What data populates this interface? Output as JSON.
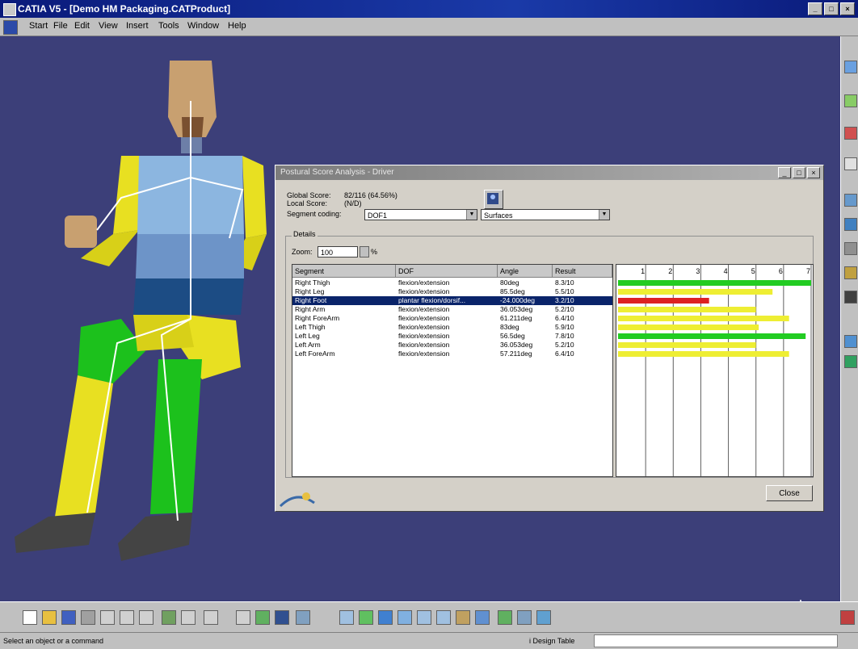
{
  "window": {
    "title": "CATIA V5 - [Demo HM Packaging.CATProduct]",
    "buttons": [
      "_",
      "□",
      "×"
    ]
  },
  "menubar": {
    "items": [
      "Start",
      "File",
      "Edit",
      "View",
      "Insert",
      "Tools",
      "Window",
      "Help"
    ]
  },
  "status": {
    "text": "Select an object or a command",
    "design_table_label": "i Design Table"
  },
  "dialog": {
    "title": "Postural Score Analysis - Driver",
    "global_score_label": "Global Score:",
    "global_score_value": "82/116  (64.56%)",
    "local_score_label": "Local Score:",
    "local_score_value": "(N/D)",
    "segment_coding_label": "Segment coding:",
    "segment_coding_value": "DOF1",
    "display_mode_value": "Surfaces",
    "details_label": "Details",
    "zoom_label": "Zoom:",
    "zoom_value": "100",
    "zoom_unit": "%",
    "close_label": "Close",
    "columns": [
      "Segment",
      "DOF",
      "Angle",
      "Result"
    ],
    "scale_ticks": [
      "1",
      "2",
      "3",
      "4",
      "5",
      "6",
      "7"
    ],
    "rows": [
      {
        "segment": "Right Thigh",
        "dof": "flexion/extension",
        "angle": "80deg",
        "result": "8.3/10",
        "score": 7.0,
        "color": "#22cc22",
        "selected": false
      },
      {
        "segment": "Right Leg",
        "dof": "flexion/extension",
        "angle": "85.5deg",
        "result": "5.5/10",
        "score": 5.6,
        "color": "#eeee33",
        "selected": false
      },
      {
        "segment": "Right Foot",
        "dof": "plantar flexion/dorsif...",
        "angle": "-24.000deg",
        "result": "3.2/10",
        "score": 3.3,
        "color": "#dd2222",
        "selected": true
      },
      {
        "segment": "Right Arm",
        "dof": "flexion/extension",
        "angle": "36.053deg",
        "result": "5.2/10",
        "score": 5.0,
        "color": "#eeee33",
        "selected": false
      },
      {
        "segment": "Right ForeArm",
        "dof": "flexion/extension",
        "angle": "61.211deg",
        "result": "6.4/10",
        "score": 6.2,
        "color": "#eeee33",
        "selected": false
      },
      {
        "segment": "Left Thigh",
        "dof": "flexion/extension",
        "angle": "83deg",
        "result": "5.9/10",
        "score": 5.1,
        "color": "#eeee33",
        "selected": false
      },
      {
        "segment": "Left Leg",
        "dof": "flexion/extension",
        "angle": "56.5deg",
        "result": "7.8/10",
        "score": 6.8,
        "color": "#22cc22",
        "selected": false
      },
      {
        "segment": "Left Arm",
        "dof": "flexion/extension",
        "angle": "36.053deg",
        "result": "5.2/10",
        "score": 5.0,
        "color": "#eeee33",
        "selected": false
      },
      {
        "segment": "Left ForeArm",
        "dof": "flexion/extension",
        "angle": "57.211deg",
        "result": "6.4/10",
        "score": 6.2,
        "color": "#eeee33",
        "selected": false
      }
    ]
  }
}
